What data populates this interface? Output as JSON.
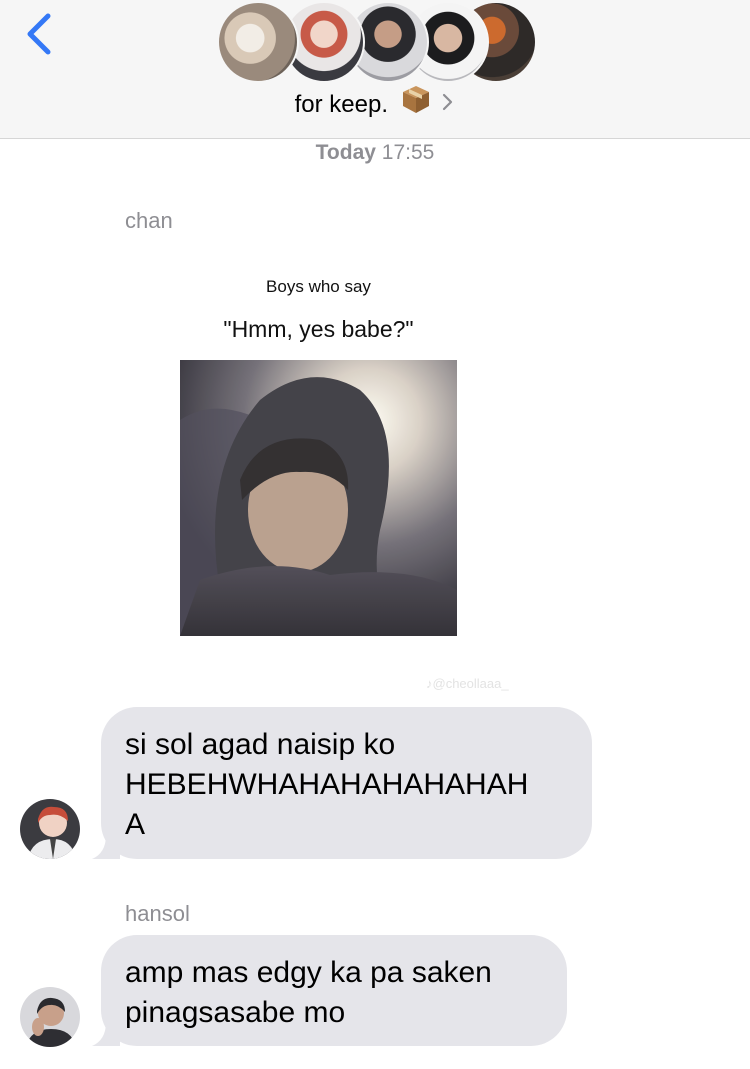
{
  "header": {
    "back_icon": "chevron-left-icon",
    "group_name": "for keep.",
    "group_emoji_icon": "package-icon",
    "chevron_icon": "chevron-right-icon",
    "accent_color": "#3478f6"
  },
  "timestamp": {
    "day": "Today",
    "time": "17:55"
  },
  "messages": [
    {
      "sender": "chan",
      "image": {
        "caption_line1": "Boys who say",
        "caption_line2": "\"Hmm, yes babe?\"",
        "watermark": "@cheollaaa_"
      },
      "text_line1": "si sol agad naisip ko",
      "text_line2": "HEBEHWHAHAHAHAHAHAH",
      "text_line3": "A"
    },
    {
      "sender": "hansol",
      "text_line1": "amp mas edgy ka pa saken",
      "text_line2": "pinagsasabe mo"
    }
  ],
  "colors": {
    "bubble_received": "#e5e5ea",
    "header_bg": "#f6f6f6",
    "meta_text": "#8e8e93"
  }
}
